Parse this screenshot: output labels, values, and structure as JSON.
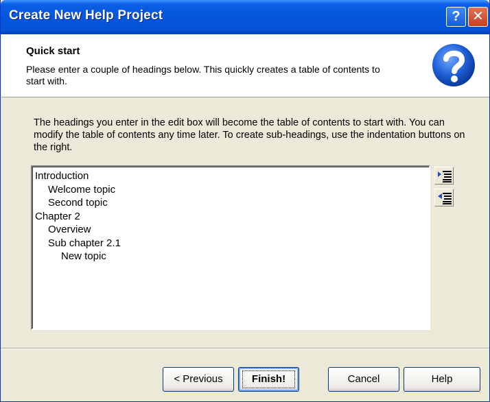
{
  "window": {
    "title": "Create New Help Project",
    "help_glyph": "?",
    "close_glyph": "✕"
  },
  "header": {
    "title": "Quick start",
    "description": "Please enter a couple of headings below. This quickly creates a table of contents to start with.",
    "badge_icon": "help-question-icon"
  },
  "intro": "The headings you enter in the edit box will become the table of contents to start with. You can modify the table of contents any time later. To create sub-headings, use the indentation buttons on the right.",
  "editbox": {
    "lines": [
      {
        "text": "Introduction",
        "level": 0
      },
      {
        "text": "Welcome topic",
        "level": 1
      },
      {
        "text": "Second topic",
        "level": 1
      },
      {
        "text": "Chapter 2",
        "level": 0
      },
      {
        "text": "Overview",
        "level": 1
      },
      {
        "text": "Sub chapter 2.1",
        "level": 1
      },
      {
        "text": "New topic",
        "level": 2
      }
    ]
  },
  "indent_buttons": [
    {
      "name": "indent-right-icon"
    },
    {
      "name": "indent-left-icon"
    }
  ],
  "buttons": {
    "previous": "< Previous",
    "finish": "Finish!",
    "cancel": "Cancel",
    "help": "Help"
  },
  "colors": {
    "titlebar": "#0556DC",
    "dialog_bg": "#ECE9D8",
    "badge_blue": "#1F5FD6"
  }
}
